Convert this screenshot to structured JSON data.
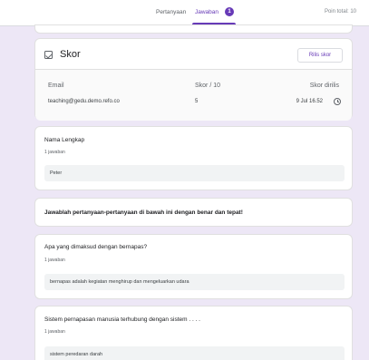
{
  "header": {
    "tabs": [
      {
        "label": "Pertanyaan",
        "active": false
      },
      {
        "label": "Jawaban",
        "active": true,
        "badge": "1"
      }
    ],
    "points_total": "Poin total: 10"
  },
  "score": {
    "icon": "checkbox-icon",
    "title": "Skor",
    "release_label": "Rilis skor",
    "columns": [
      "Email",
      "Skor / 10",
      "Skor dirilis"
    ],
    "row": {
      "email": "teaching@gedu.demo.refo.co",
      "score": "5",
      "released": "9 Jul 16.52"
    }
  },
  "questions": [
    {
      "title": "Nama Lengkap",
      "count": "1 jawaban",
      "answer": "Peter"
    },
    {
      "title": "Apa yang dimaksud dengan bernapas?",
      "count": "1 jawaban",
      "answer": "bernapas adalah kegiatan menghirup dan mengeluarkan udara"
    },
    {
      "title": "Sistem pernapasan manusia terhubung dengan sistem . . . .",
      "count": "1 jawaban",
      "answer": "sistem peredaran darah"
    }
  ],
  "instruction": "Jawablah pertanyaan-pertanyaan di bawah ini dengan benar dan tepat!",
  "colors": {
    "accent": "#673ab7",
    "background": "#ede7f6"
  }
}
